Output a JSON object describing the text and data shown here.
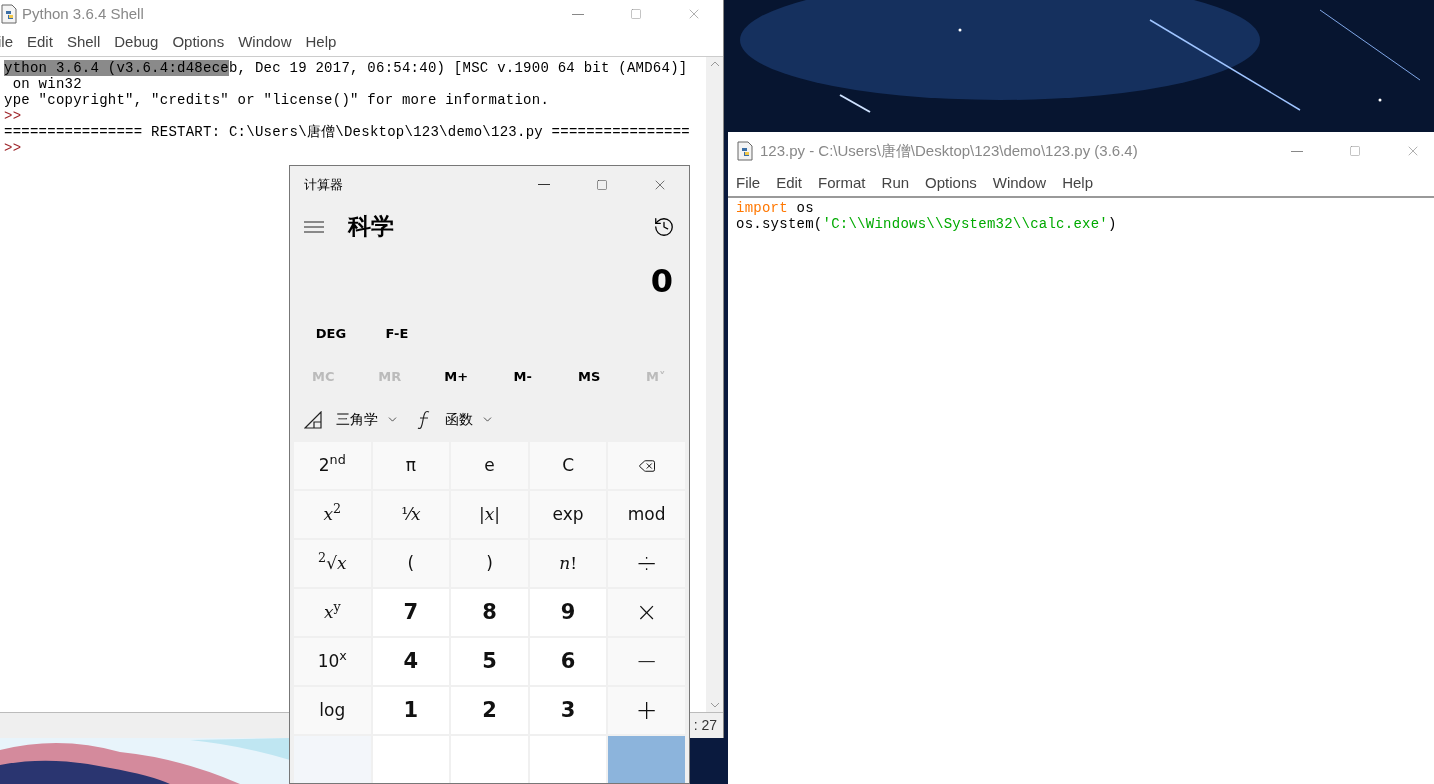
{
  "shell_window": {
    "title": "Python 3.6.4 Shell",
    "menu": [
      "ile",
      "Edit",
      "Shell",
      "Debug",
      "Options",
      "Window",
      "Help"
    ],
    "lines": [
      {
        "kind": "output",
        "selection": "ython 3.6.4 (v3.6.4:d48ece",
        "text": "b, Dec 19 2017, 06:54:40) [MSC v.1900 64 bit (AMD64)]"
      },
      {
        "kind": "output",
        "text": " on win32"
      },
      {
        "kind": "output",
        "text": "ype \"copyright\", \"credits\" or \"license()\" for more information."
      },
      {
        "kind": "prompt",
        "text": ">>"
      },
      {
        "kind": "output",
        "text": "================ RESTART: C:\\Users\\唐僧\\Desktop\\123\\demo\\123.py ================"
      },
      {
        "kind": "prompt",
        "text": ">>"
      }
    ],
    "status": ": 27"
  },
  "calculator": {
    "title": "计算器",
    "mode": "科学",
    "display": "0",
    "angle_buttons": [
      "DEG",
      "F-E"
    ],
    "memory": [
      {
        "label": "MC",
        "disabled": true
      },
      {
        "label": "MR",
        "disabled": true
      },
      {
        "label": "M+",
        "disabled": false
      },
      {
        "label": "M-",
        "disabled": false
      },
      {
        "label": "MS",
        "disabled": false
      },
      {
        "label": "M˅",
        "disabled": true
      }
    ],
    "dropdowns": [
      {
        "kind": "trig",
        "label": "三角学"
      },
      {
        "kind": "function",
        "label": "函数"
      }
    ],
    "keys": [
      [
        {
          "kind": "fn",
          "label": "2$^{nd}$"
        },
        {
          "kind": "fn",
          "label": "π"
        },
        {
          "kind": "fn",
          "label": "e"
        },
        {
          "kind": "fn",
          "label": "C"
        },
        {
          "kind": "backspace"
        }
      ],
      [
        {
          "kind": "math",
          "label": "*x*$^{2}$"
        },
        {
          "kind": "math",
          "label": "¹⁄*x*"
        },
        {
          "kind": "math",
          "label": "|*x*|"
        },
        {
          "kind": "fn",
          "label": "exp"
        },
        {
          "kind": "fn",
          "label": "mod"
        }
      ],
      [
        {
          "kind": "math",
          "label": "$^{2}$√*x*"
        },
        {
          "kind": "fn",
          "label": "("
        },
        {
          "kind": "fn",
          "label": ")"
        },
        {
          "kind": "math",
          "label": "*n*!"
        },
        {
          "kind": "op",
          "label": "÷"
        }
      ],
      [
        {
          "kind": "math",
          "label": "*x*$^{y}$"
        },
        {
          "kind": "digit",
          "label": "7"
        },
        {
          "kind": "digit",
          "label": "8"
        },
        {
          "kind": "digit",
          "label": "9"
        },
        {
          "kind": "op",
          "label": "×"
        }
      ],
      [
        {
          "kind": "fn",
          "label": "10$^{x}$"
        },
        {
          "kind": "digit",
          "label": "4"
        },
        {
          "kind": "digit",
          "label": "5"
        },
        {
          "kind": "digit",
          "label": "6"
        },
        {
          "kind": "op",
          "label": "−"
        }
      ],
      [
        {
          "kind": "fn",
          "label": "log"
        },
        {
          "kind": "digit",
          "label": "1"
        },
        {
          "kind": "digit",
          "label": "2"
        },
        {
          "kind": "digit",
          "label": "3"
        },
        {
          "kind": "op",
          "label": "+"
        }
      ]
    ]
  },
  "editor_window": {
    "title": "123.py - C:\\Users\\唐僧\\Desktop\\123\\demo\\123.py (3.6.4)",
    "menu": [
      "File",
      "Edit",
      "Format",
      "Run",
      "Options",
      "Window",
      "Help"
    ],
    "code": [
      [
        {
          "kind": "keyword",
          "text": "import"
        },
        {
          "kind": "plain",
          "text": " os"
        }
      ],
      [
        {
          "kind": "plain",
          "text": "os.system("
        },
        {
          "kind": "string",
          "text": "'C:\\\\Windows\\\\System32\\\\calc.exe'"
        },
        {
          "kind": "plain",
          "text": ")"
        }
      ]
    ]
  }
}
